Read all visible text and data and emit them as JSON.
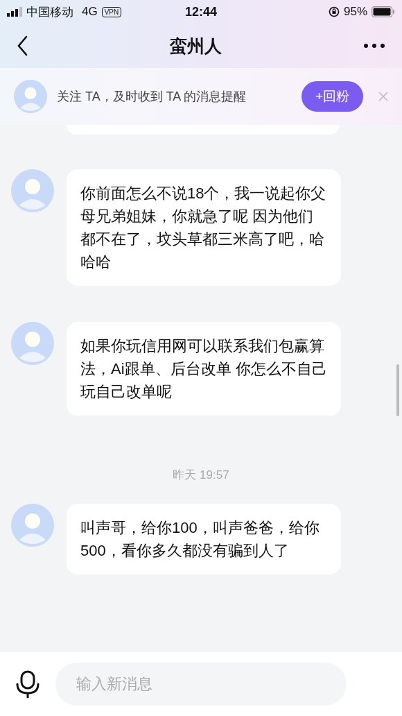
{
  "status_bar": {
    "carrier": "中国移动",
    "network": "4G",
    "vpn": "VPN",
    "time": "12:44",
    "battery": "95%"
  },
  "header": {
    "title": "蛮州人"
  },
  "follow_banner": {
    "text": "关注 TA，及时收到 TA 的消息提醒",
    "button": "+回粉"
  },
  "messages": [
    {
      "kind": "message",
      "text": "你前面怎么不说18个，我一说起你父母兄弟姐妹，你就急了呢 因为他们都不在了，坟头草都三米高了吧，哈哈哈"
    },
    {
      "kind": "message",
      "text": "如果你玩信用网可以联系我们包赢算法，Ai跟单、后台改单 你怎么不自己玩自己改单呢"
    },
    {
      "kind": "time",
      "text": "昨天 19:57"
    },
    {
      "kind": "message",
      "text": "叫声哥，给你100，叫声爸爸，给你500，看你多久都没有骗到人了"
    }
  ],
  "input": {
    "placeholder": "输入新消息"
  }
}
